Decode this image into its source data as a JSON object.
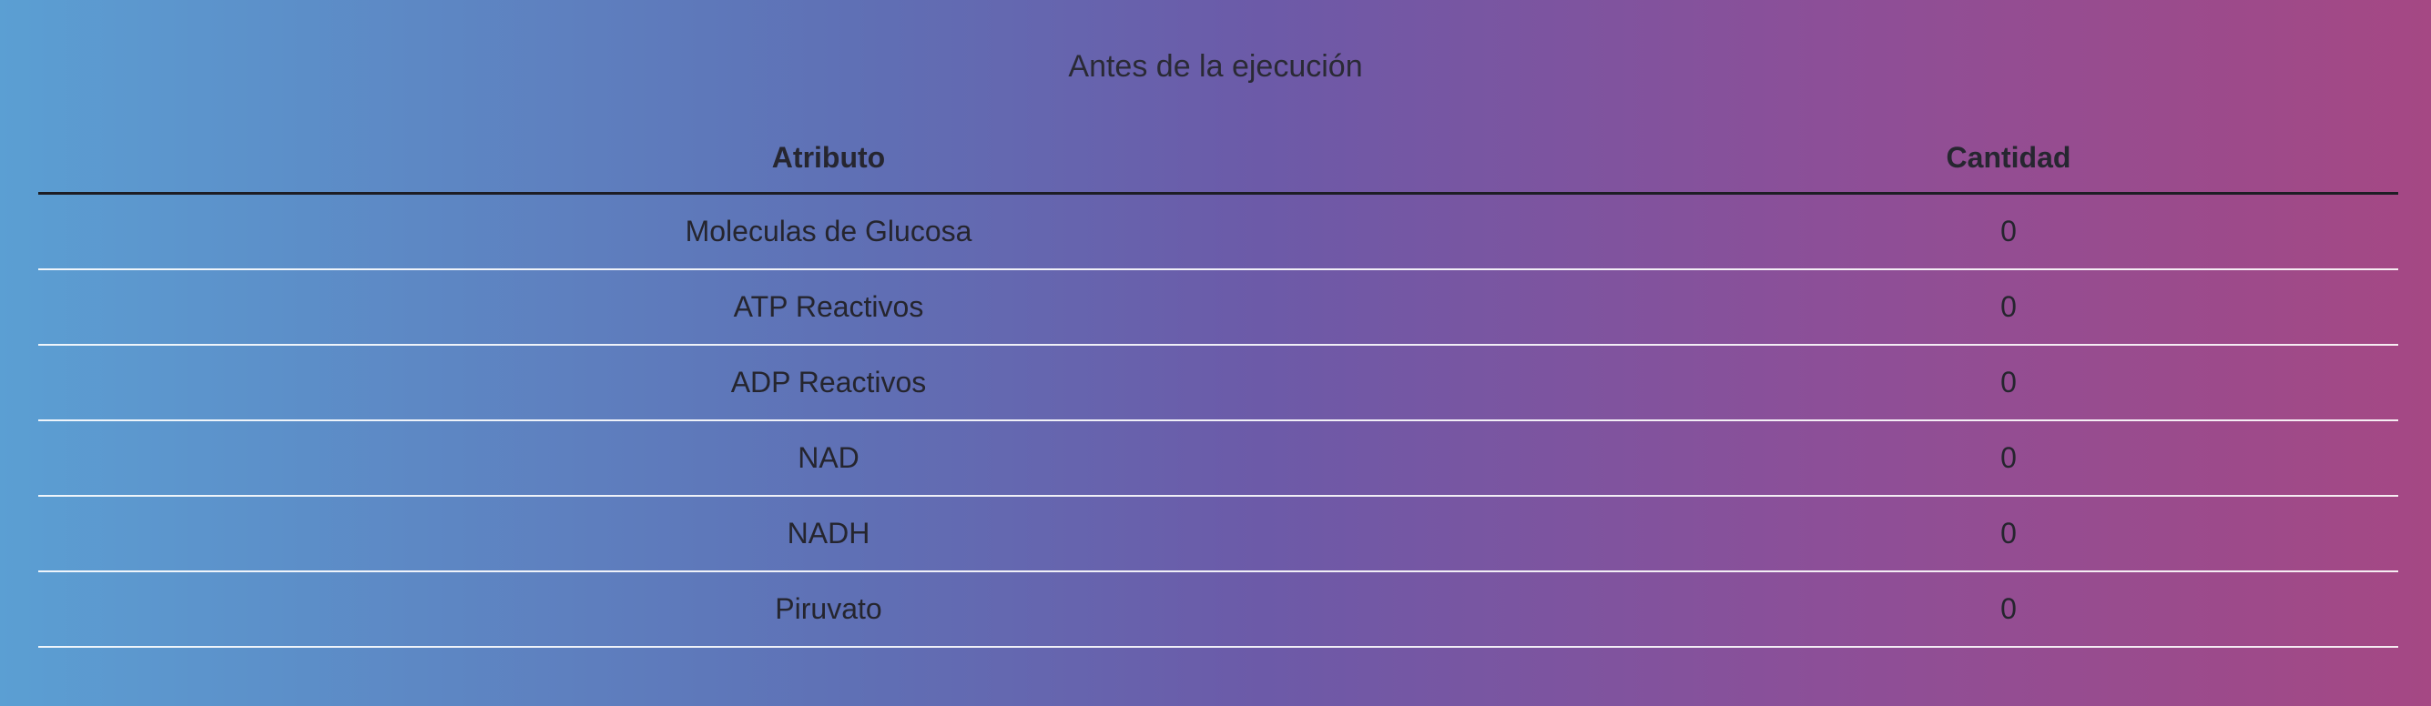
{
  "title": "Antes de la ejecución",
  "table": {
    "headers": [
      "Atributo",
      "Cantidad"
    ],
    "rows": [
      {
        "attribute": "Moleculas de Glucosa",
        "quantity": "0"
      },
      {
        "attribute": "ATP Reactivos",
        "quantity": "0"
      },
      {
        "attribute": "ADP Reactivos",
        "quantity": "0"
      },
      {
        "attribute": "NAD",
        "quantity": "0"
      },
      {
        "attribute": "NADH",
        "quantity": "0"
      },
      {
        "attribute": "Piruvato",
        "quantity": "0"
      }
    ]
  },
  "colors": {
    "gradient_start": "#5b9fd3",
    "gradient_mid": "#6c5aa8",
    "gradient_end": "#a54884"
  }
}
